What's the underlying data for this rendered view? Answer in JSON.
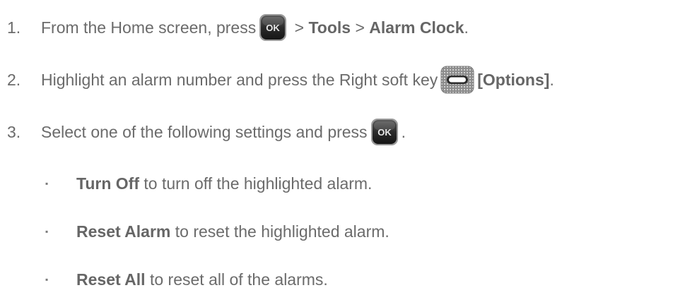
{
  "steps": [
    {
      "number": "1.",
      "text_before": "From the Home screen, press",
      "sep1": " > ",
      "bold1": "Tools",
      "sep2": " > ",
      "bold2": "Alarm Clock",
      "end": "."
    },
    {
      "number": "2.",
      "text_before": "Highlight an alarm number and press the Right soft key",
      "bold1": "[Options]",
      "end": "."
    },
    {
      "number": "3.",
      "text_before": "Select one of the following settings and press",
      "end": "."
    }
  ],
  "options": [
    {
      "bullet": "▪",
      "bold": "Turn Off",
      "text": " to turn off the highlighted alarm."
    },
    {
      "bullet": "▪",
      "bold": "Reset Alarm",
      "text": " to reset the highlighted alarm."
    },
    {
      "bullet": "▪",
      "bold": "Reset All",
      "text": " to reset all of the alarms."
    }
  ],
  "keys": {
    "ok_label": "OK"
  },
  "colors": {
    "text": "#6b6b6b",
    "key_body": "#3a3a3a",
    "key_rim": "#8a8a8a"
  },
  "icons": [
    "ok-key-icon",
    "right-soft-key-icon"
  ]
}
